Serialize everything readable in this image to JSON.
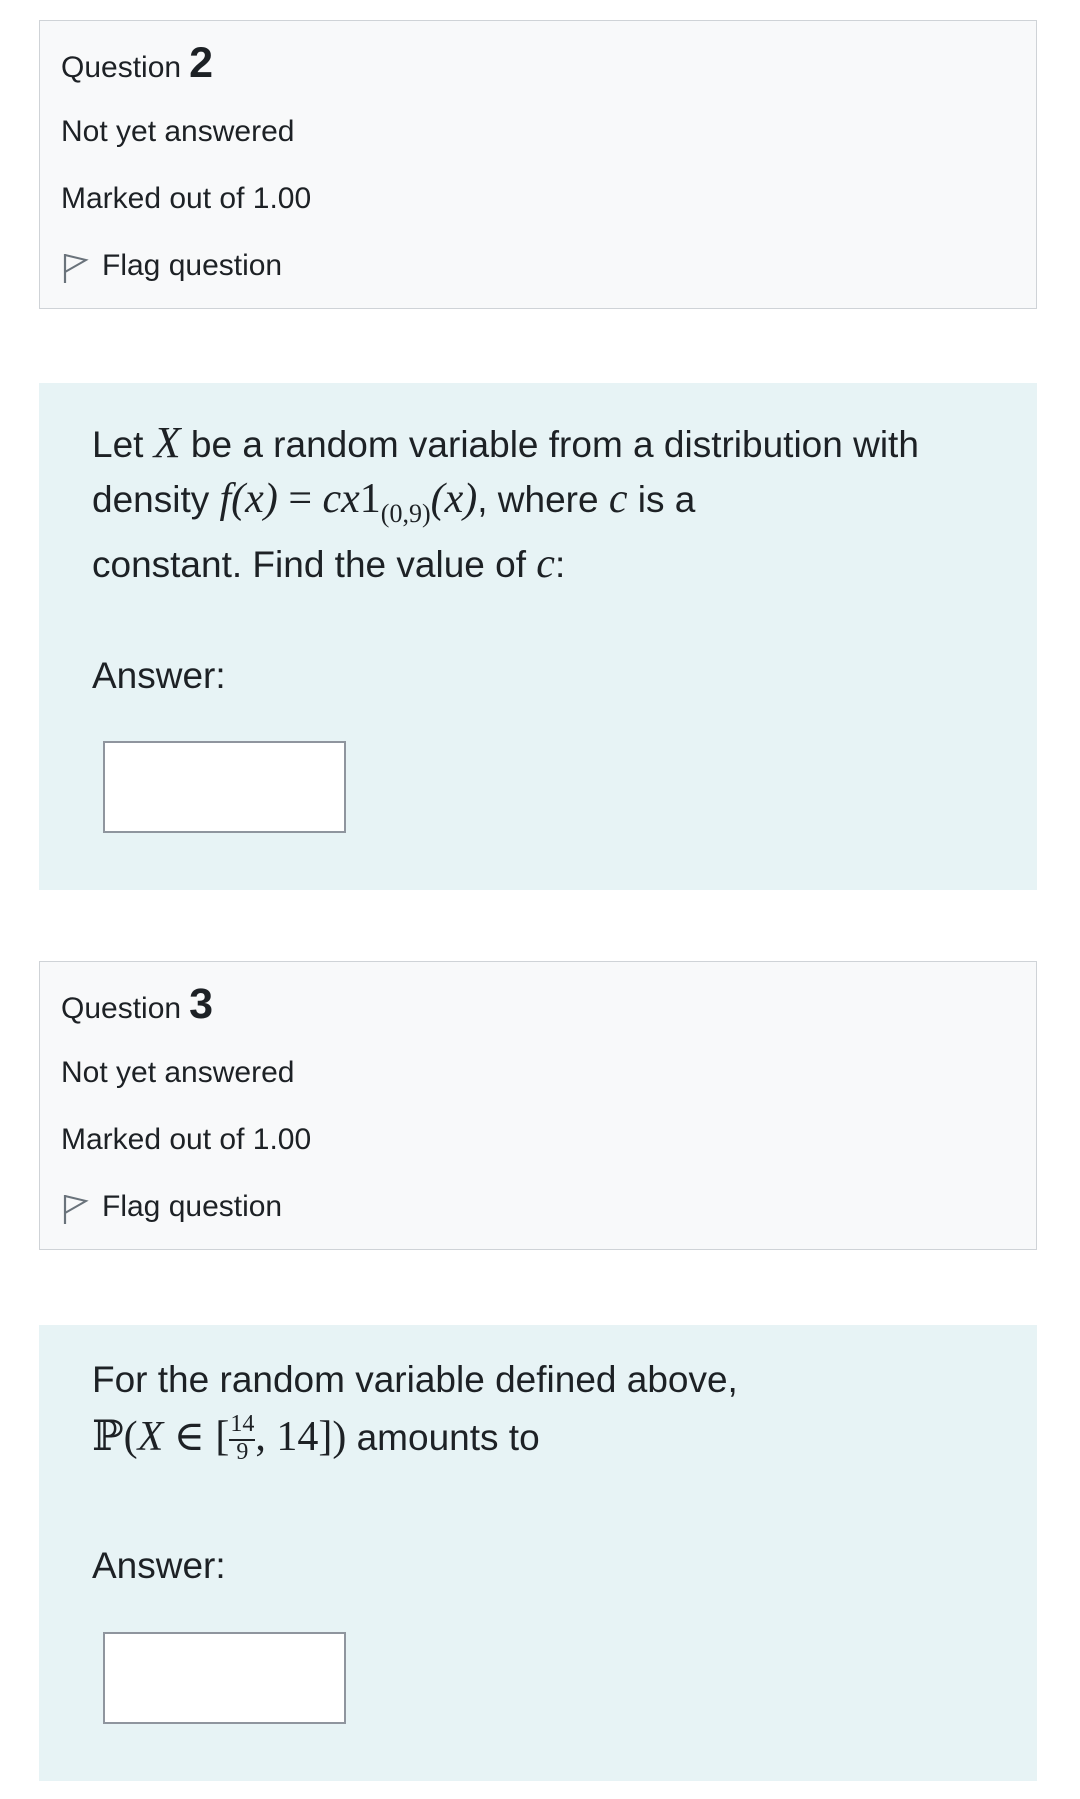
{
  "questions": [
    {
      "info": {
        "question_label": "Question",
        "number": "2",
        "state": "Not yet answered",
        "grade": "Marked out of 1.00",
        "flag_label": "Flag question"
      },
      "text": {
        "line1_pre": "Let ",
        "var_X": "X",
        "line1_post": " be a random variable from a distribution with",
        "line2_pre": "density ",
        "density_lhs": "f(x)",
        "equals": " = ",
        "density_rhs_cx": "cx",
        "indicator": "1",
        "indicator_sub": "(0,9)",
        "indicator_arg": "(x)",
        "line2_post": ", where ",
        "var_c": "c",
        "line2_end": " is a",
        "line3_pre": "constant. Find the value of ",
        "var_c2": "c",
        "line3_end": ":"
      },
      "answer_label": "Answer:",
      "answer_value": ""
    },
    {
      "info": {
        "question_label": "Question",
        "number": "3",
        "state": "Not yet answered",
        "grade": "Marked out of 1.00",
        "flag_label": "Flag question"
      },
      "text": {
        "line1": "For the random variable defined above,",
        "prob_P": "ℙ",
        "prob_open": "(",
        "var_X": "X",
        "in_symbol": " ∈ [",
        "frac_num": "14",
        "frac_den": "9",
        "interval_rest": ", 14]",
        "prob_close": ")",
        "line2_post": " amounts to"
      },
      "answer_label": "Answer:",
      "answer_value": ""
    }
  ]
}
